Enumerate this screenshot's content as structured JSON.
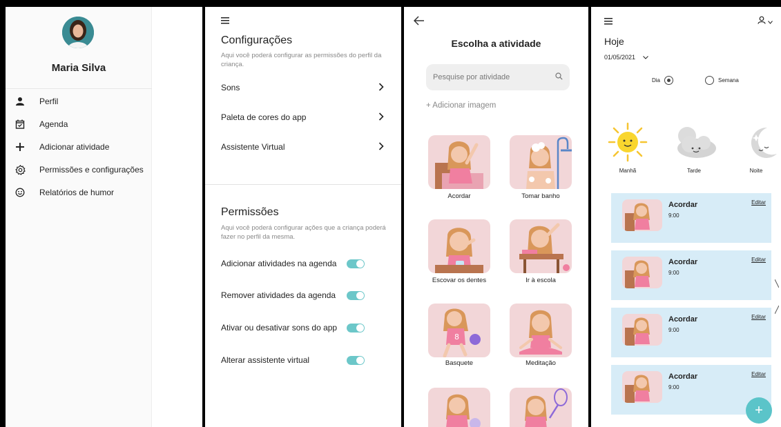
{
  "drawer": {
    "user_name": "Maria Silva",
    "items": [
      {
        "label": "Perfil",
        "icon": "person-icon"
      },
      {
        "label": "Agenda",
        "icon": "calendar-check-icon"
      },
      {
        "label": "Adicionar atividade",
        "icon": "plus-icon"
      },
      {
        "label": "Permissões e configurações",
        "icon": "gear-icon"
      },
      {
        "label": "Relatórios de humor",
        "icon": "smiley-icon"
      }
    ]
  },
  "settings": {
    "config_title": "Configurações",
    "config_subtitle": "Aqui você poderá configurar as permissões do perfil da criança.",
    "config_rows": [
      "Sons",
      "Paleta de cores do app",
      "Assistente Virtual"
    ],
    "perm_title": "Permissões",
    "perm_subtitle": "Aqui você poderá configurar ações que a criança poderá fazer no perfil da mesma.",
    "perm_rows": [
      {
        "label": "Adicionar atividades na agenda",
        "on": true
      },
      {
        "label": "Remover atividades da agenda",
        "on": true
      },
      {
        "label": "Ativar ou desativar sons do app",
        "on": true
      },
      {
        "label": "Alterar assistente virtual",
        "on": true
      }
    ]
  },
  "activities": {
    "title": "Escolha a atividade",
    "search_placeholder": "Pesquise por atividade",
    "add_image": "+ Adicionar imagem",
    "items": [
      "Acordar",
      "Tomar banho",
      "Escovar os dentes",
      "Ir à escola",
      "Basquete",
      "Meditação"
    ]
  },
  "schedule": {
    "title": "Hoje",
    "date": "01/05/2021",
    "view_options": [
      {
        "label": "Dia",
        "selected": true
      },
      {
        "label": "Semana",
        "selected": false
      }
    ],
    "periods": [
      "Manhã",
      "Tarde",
      "Noite"
    ],
    "entries": [
      {
        "name": "Acordar",
        "time": "9:00",
        "edit": "Editar"
      },
      {
        "name": "Acordar",
        "time": "9:00",
        "edit": "Editar"
      },
      {
        "name": "Acordar",
        "time": "9:00",
        "edit": "Editar"
      },
      {
        "name": "Acordar",
        "time": "9:00",
        "edit": "Editar"
      }
    ],
    "fab": "+"
  },
  "colors": {
    "accent": "#5bc4c9",
    "card_blue": "#d7ecf7",
    "card_pink": "#f2d6d8"
  }
}
